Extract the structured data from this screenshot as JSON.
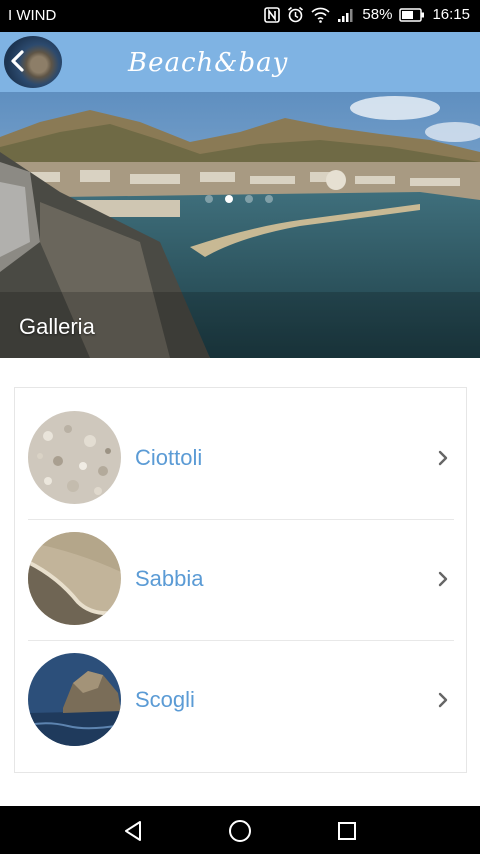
{
  "status_bar": {
    "carrier": "I WIND",
    "battery": "58%",
    "time": "16:15"
  },
  "app_bar": {
    "title": "Beach&bay",
    "back_icon": "chevron-left-icon"
  },
  "hero": {
    "title": "Galleria",
    "carousel_pages": 4,
    "active_page": 2
  },
  "list": {
    "items": [
      {
        "label": "Ciottoli",
        "icon": "chevron-right-icon"
      },
      {
        "label": "Sabbia",
        "icon": "chevron-right-icon"
      },
      {
        "label": "Scogli",
        "icon": "chevron-right-icon"
      }
    ]
  },
  "colors": {
    "app_bar": "#7fb3e3",
    "accent_text": "#5b9bd5"
  },
  "nav_bar": {
    "back": "triangle-back-icon",
    "home": "circle-home-icon",
    "recents": "square-recents-icon"
  }
}
